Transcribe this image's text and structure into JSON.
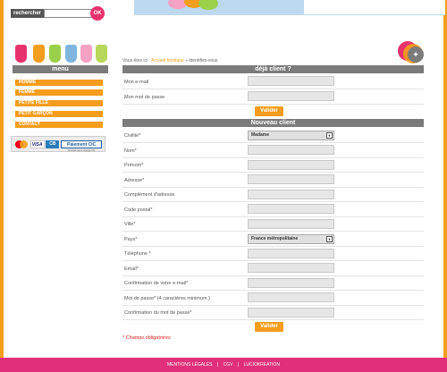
{
  "search": {
    "label": "rechercher",
    "button_label": "OK"
  },
  "menu": {
    "title": "menu",
    "items": [
      {
        "label": "HOMME"
      },
      {
        "label": "FEMME"
      },
      {
        "label": "PETITE FILLE"
      },
      {
        "label": "PETIT GARÇON"
      },
      {
        "label": "CONTACT"
      }
    ]
  },
  "payment": {
    "visa": "VISA",
    "cb": "CB",
    "paiement_cic": "Paiement CIC",
    "cic_sub": "Sécurisé par le Groupe CIC"
  },
  "breadcrumb": {
    "prefix": "Vous êtes ici :",
    "link": "Accueil boutique",
    "separator": "»",
    "current": "Identifiez-vous"
  },
  "existing_client": {
    "header": "déjà client ?",
    "fields": [
      {
        "label": "Mon e-mail"
      },
      {
        "label": "Mon mot de passe"
      }
    ],
    "submit_label": "Valider"
  },
  "new_client": {
    "header": "Nouveau client",
    "fields": [
      {
        "label": "Civilité*",
        "type": "select",
        "value": "Madame"
      },
      {
        "label": "Nom*",
        "type": "text"
      },
      {
        "label": "Prénom*",
        "type": "text"
      },
      {
        "label": "Adresse*",
        "type": "text"
      },
      {
        "label": "Complément d'adresse",
        "type": "text"
      },
      {
        "label": "Code postal*",
        "type": "text"
      },
      {
        "label": "Ville*",
        "type": "text"
      },
      {
        "label": "Pays*",
        "type": "select",
        "value": "France métropolitaine"
      },
      {
        "label": "Téléphone *",
        "type": "text"
      },
      {
        "label": "Email*",
        "type": "text"
      },
      {
        "label": "Confirmation de votre e-mail*",
        "type": "text"
      },
      {
        "label": "Mot de passe* (4 caractères minimum )",
        "type": "text"
      },
      {
        "label": "Confirmation du mot de passe*",
        "type": "text"
      }
    ],
    "submit_label": "Valider"
  },
  "required_note": "* Champs obligatoires",
  "footer": {
    "links": [
      "MENTIONS LÉGALES",
      "CGV",
      "LUCIOKREATION"
    ],
    "separator": "|"
  },
  "colors": {
    "accent_orange": "#f59d1c",
    "pink": "#e0307a",
    "header_gray": "#7b7b7b"
  },
  "icons": {
    "select_arrow": "chevron-down-icon"
  }
}
